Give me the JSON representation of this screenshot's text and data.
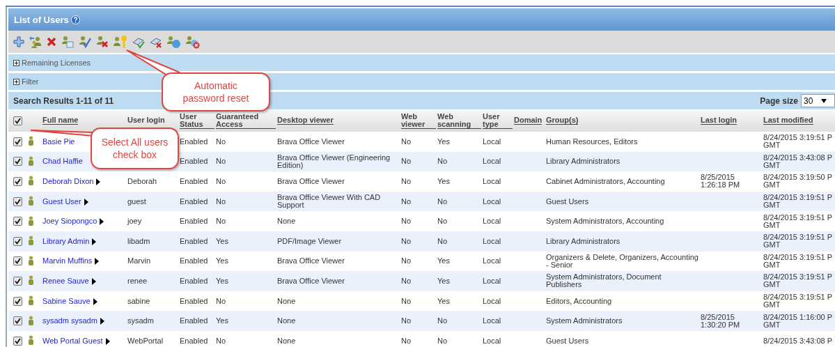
{
  "panel": {
    "title": "List of Users"
  },
  "sections": [
    {
      "label": "Remaining Licenses",
      "expanded": false
    },
    {
      "label": "Filter",
      "expanded": false
    }
  ],
  "results": {
    "summary": "Search Results 1-11 of 11",
    "page_size_label": "Page size",
    "page_size": "30"
  },
  "select_all": {
    "checked": true
  },
  "columns": [
    {
      "label": "Full name",
      "sortable": true
    },
    {
      "label": "User login",
      "sortable": false
    },
    {
      "label": "User Status",
      "sortable": true
    },
    {
      "label": "Guaranteed Access",
      "sortable": true
    },
    {
      "label": "Desktop viewer",
      "sortable": true
    },
    {
      "label": "Web viewer",
      "sortable": true
    },
    {
      "label": "Web scanning",
      "sortable": true
    },
    {
      "label": "User type",
      "sortable": true
    },
    {
      "label": "Domain",
      "sortable": true
    },
    {
      "label": "Group(s)",
      "sortable": true
    },
    {
      "label": "Last login",
      "sortable": true
    },
    {
      "label": "Last modified",
      "sortable": true
    }
  ],
  "rows": [
    {
      "checked": true,
      "name": "Basie Pie",
      "arrow": false,
      "status": "Enabled",
      "guaranteed": "No",
      "desktop": "Brava Office Viewer",
      "web_viewer": "No",
      "web_scanning": "Yes",
      "type": "Local",
      "groups": "Human Resources, Editors",
      "modified": "8/24/2015 3:19:51 P GMT"
    },
    {
      "checked": true,
      "name": "Chad Haffie",
      "arrow": false,
      "status": "Enabled",
      "guaranteed": "No",
      "desktop": "Brava Office Viewer (Engineering Edition)",
      "web_viewer": "No",
      "web_scanning": "No",
      "type": "Local",
      "groups": "Library Administrators",
      "modified": "8/24/2015 3:43:08 P GMT"
    },
    {
      "checked": true,
      "name": "Deborah Dixon",
      "arrow": true,
      "login": "Deborah",
      "status": "Enabled",
      "guaranteed": "No",
      "desktop": "Brava Office Viewer",
      "web_viewer": "No",
      "web_scanning": "Yes",
      "type": "Local",
      "groups": "Cabinet Administrators, Accounting",
      "last_login": "8/25/2015 1:26:18 PM",
      "modified": "8/24/2015 3:19:50 P GMT"
    },
    {
      "checked": true,
      "name": "Guest User",
      "arrow": true,
      "login": "guest",
      "status": "Enabled",
      "guaranteed": "No",
      "desktop": "Brava Office Viewer With CAD Support",
      "web_viewer": "No",
      "web_scanning": "No",
      "type": "Local",
      "groups": "Guest Users",
      "modified": "8/24/2015 3:19:51 P GMT"
    },
    {
      "checked": true,
      "name": "Joey Siopongco",
      "arrow": true,
      "login": "joey",
      "status": "Enabled",
      "guaranteed": "No",
      "desktop": "None",
      "web_viewer": "No",
      "web_scanning": "No",
      "type": "Local",
      "groups": "System Administrators, Accounting",
      "modified": "8/24/2015 3:19:51 P GMT"
    },
    {
      "checked": true,
      "name": "Library Admin",
      "arrow": true,
      "login": "libadm",
      "status": "Enabled",
      "guaranteed": "Yes",
      "desktop": "PDF/Image Viewer",
      "web_viewer": "No",
      "web_scanning": "No",
      "type": "Local",
      "groups": "Library Administrators",
      "modified": "8/24/2015 3:19:51 P GMT"
    },
    {
      "checked": true,
      "name": "Marvin Muffins",
      "arrow": true,
      "login": "Marvin",
      "status": "Enabled",
      "guaranteed": "Yes",
      "desktop": "Brava Office Viewer",
      "web_viewer": "No",
      "web_scanning": "Yes",
      "type": "Local",
      "groups": "Organizers & Delete, Organizers, Accounting - Senior",
      "modified": "8/24/2015 3:19:51 P GMT"
    },
    {
      "checked": true,
      "name": "Renee Sauve",
      "arrow": true,
      "login": "renee",
      "status": "Enabled",
      "guaranteed": "Yes",
      "desktop": "Brava Office Viewer",
      "web_viewer": "No",
      "web_scanning": "Yes",
      "type": "Local",
      "groups": "System Administrators, Document Publishers",
      "modified": "8/24/2015 3:19:51 P GMT"
    },
    {
      "checked": true,
      "name": "Sabine Sauve",
      "arrow": true,
      "login": "sabine",
      "status": "Enabled",
      "guaranteed": "No",
      "desktop": "None",
      "web_viewer": "No",
      "web_scanning": "Yes",
      "type": "Local",
      "groups": "Editors, Accounting",
      "modified": "8/24/2015 3:19:51 P GMT"
    },
    {
      "checked": true,
      "name": "sysadm sysadm",
      "arrow": true,
      "login": "sysadm",
      "status": "Enabled",
      "guaranteed": "Yes",
      "desktop": "None",
      "web_viewer": "No",
      "web_scanning": "No",
      "type": "Local",
      "groups": "System Administrators",
      "last_login": "8/25/2015 1:30:20 PM",
      "modified": "8/24/2015 1:16:00 P GMT"
    },
    {
      "checked": true,
      "name": "Web Portal Guest",
      "arrow": true,
      "login": "WebPortal",
      "status": "Enabled",
      "guaranteed": "No",
      "desktop": "None",
      "web_viewer": "No",
      "web_scanning": "No",
      "type": "Local",
      "groups": "Guest Users",
      "modified": "8/24/2015 3:43:08 P"
    }
  ],
  "callouts": [
    {
      "text": "Automatic password reset",
      "kind": "password"
    },
    {
      "text": "Select All users check box",
      "kind": "select"
    }
  ]
}
